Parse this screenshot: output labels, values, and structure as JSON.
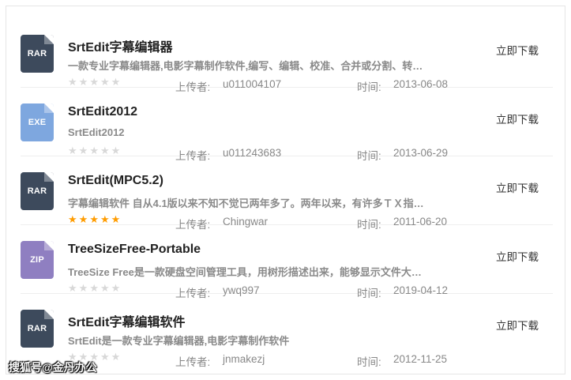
{
  "colors": {
    "rar": "#3d4a5c",
    "exe": "#7ea7df",
    "zip": "#8f7fc1",
    "star_on": "#ff9c00",
    "star_off": "#d8d8d8"
  },
  "labels": {
    "uploader": "上传者:",
    "time": "时间:",
    "download": "立即下载"
  },
  "items": [
    {
      "ext": "RAR",
      "title": "SrtEdit字幕编辑器",
      "desc": "一款专业字幕编辑器,电影字幕制作软件,编写、编辑、校准、合并或分割、转…",
      "rating": 0,
      "uploader": "u011004107",
      "time": "2013-06-08"
    },
    {
      "ext": "EXE",
      "title": "SrtEdit2012",
      "desc": "SrtEdit2012",
      "rating": 0,
      "uploader": "u011243683",
      "time": "2013-06-29"
    },
    {
      "ext": "RAR",
      "title": "SrtEdit(MPC5.2)",
      "desc": "字幕编辑软件 自从4.1版以来不知不觉已两年多了。两年以来，有许多ＴＸ指…",
      "rating": 5,
      "uploader": "Chingwar",
      "time": "2011-06-20"
    },
    {
      "ext": "ZIP",
      "title": "TreeSizeFree-Portable",
      "desc": "TreeSize Free是一款硬盘空间管理工具，用树形描述出来，能够显示文件大…",
      "rating": 0,
      "uploader": "ywq997",
      "time": "2019-04-12"
    },
    {
      "ext": "RAR",
      "title": "SrtEdit字幕编辑软件",
      "desc": "SrtEdit是一款专业字幕编辑器,电影字幕制作软件",
      "rating": 0,
      "uploader": "jnmakezj",
      "time": "2012-11-25"
    }
  ],
  "watermark": "搜狐号@金丹办公"
}
